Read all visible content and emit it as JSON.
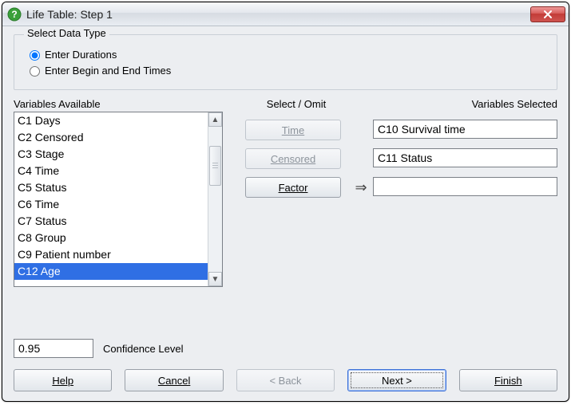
{
  "title": "Life Table: Step 1",
  "groupbox": {
    "legend": "Select Data Type",
    "options": {
      "durations": "Enter Durations",
      "begin_end": "Enter Begin and End Times"
    },
    "selected": "durations"
  },
  "labels": {
    "variables_available": "Variables Available",
    "select_omit": "Select / Omit",
    "variables_selected": "Variables Selected",
    "confidence_level": "Confidence Level"
  },
  "variables_available": [
    "C1 Days",
    "C2 Censored",
    "C3 Stage",
    "C4 Time",
    "C5 Status",
    "C6 Time",
    "C7 Status",
    "C8 Group",
    "C9 Patient number",
    "C12 Age"
  ],
  "selected_index": 9,
  "select_omit": {
    "time": "Time",
    "censored": "Censored",
    "factor": "Factor"
  },
  "selected_fields": {
    "time": "C10 Survival time",
    "censored": "C11 Status",
    "factor": ""
  },
  "arrow": "⇒",
  "confidence_value": "0.95",
  "buttons": {
    "help": "Help",
    "cancel": "Cancel",
    "back": "< Back",
    "next": "Next >",
    "finish": "Finish"
  }
}
